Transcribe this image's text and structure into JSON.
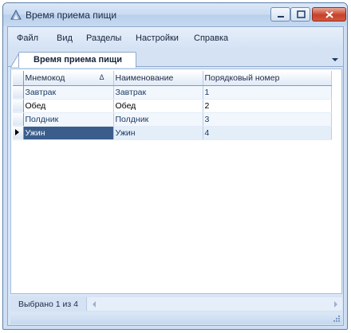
{
  "window": {
    "title": "Время приема пищи"
  },
  "menu": [
    "Файл",
    "Вид",
    "Разделы",
    "Настройки",
    "Справка"
  ],
  "tab": {
    "label": "Время приема пищи"
  },
  "grid": {
    "columns": [
      "Мнемокод",
      "Наименование",
      "Порядковый номер"
    ],
    "rows": [
      [
        "Завтрак",
        "Завтрак",
        "1"
      ],
      [
        "Обед",
        "Обед",
        "2"
      ],
      [
        "Полдник",
        "Полдник",
        "3"
      ],
      [
        "Ужин",
        "Ужин",
        "4"
      ]
    ],
    "selected_row": 3,
    "sort_glyph": "Δ"
  },
  "status": {
    "text": "Выбрано 1 из 4"
  },
  "colors": {
    "selection": "#3a5d8c",
    "frame": "#d8e6f6"
  }
}
